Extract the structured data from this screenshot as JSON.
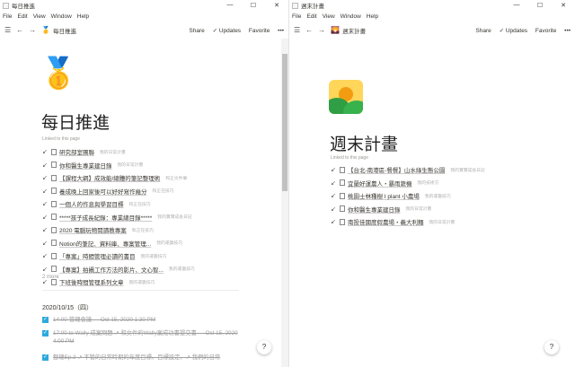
{
  "left": {
    "titlebar": "每日推進",
    "menu": [
      "File",
      "Edit",
      "View",
      "Window",
      "Help"
    ],
    "breadcrumb": "每日推進",
    "toolbar": {
      "share": "Share",
      "updates": "Updates",
      "favorite": "Favorite",
      "more": "•••"
    },
    "page_icon": "🥇",
    "title": "每日推進",
    "linked_label": "Linked to this page",
    "links": [
      {
        "title": "研究部室團聯",
        "sub": "我的日常計畫"
      },
      {
        "title": "你和醫生專業建日錄",
        "sub": "我的日常計畫"
      },
      {
        "title": "【課程大綱】成效能/總體的筆記整理術",
        "sub": "和正文件筆"
      },
      {
        "title": "養成晚上回家後可以好好寫作幾分",
        "sub": "和正在技巧"
      },
      {
        "title": "一個人的作息與學習目標",
        "sub": "和正在技巧"
      },
      {
        "title": "*****孩子成長紀錄：專業總目錄*****",
        "sub": "我的寶寶成長日記"
      },
      {
        "title": "2020 電腦玩物閱讀教專案",
        "sub": "和正在技巧"
      },
      {
        "title": "Notion的筆記、資料庫、專案管理...",
        "sub": "我的運籌技巧"
      },
      {
        "title": "「專案」時間管理必讀的書目",
        "sub": "我的運籌技巧"
      },
      {
        "title": "【專案】拍攝工作方法的影片、文心智...",
        "sub": "我的運籌技巧"
      },
      {
        "title": "下班後時間管理系列文章",
        "sub": "我的運籌技巧"
      }
    ],
    "more": "2 more",
    "date": "2020/10/15（四）",
    "todos": [
      {
        "text": "14:00-管理會議 — Oct 15, 2020 1:30 PM"
      },
      {
        "text": "17:00 to Wally 成案問題 ↗ 和文件的Wally案成功書提交書 — Oct 15, 2020 4:00 PM"
      },
      {
        "text": "整理Ep.3 ↗ 不管的日常時期的年度目標、目標設定、↗ 我們的日常"
      }
    ],
    "help": "?"
  },
  "right": {
    "titlebar": "週末計畫",
    "menu": [
      "File",
      "Edit",
      "View",
      "Window",
      "Help"
    ],
    "breadcrumb": "週末計畫",
    "toolbar": {
      "share": "Share",
      "updates": "Updates",
      "favorite": "Favorite",
      "more": "•••"
    },
    "title": "週末計畫",
    "linked_label": "Linked to this page",
    "links": [
      {
        "title": "【台北-南港區-餐餐】山水綠生態公園",
        "sub": "我的寶寶成長日記"
      },
      {
        "title": "宜蘭好運農人・暴雨蔬機",
        "sub": "我的技術方"
      },
      {
        "title": "桃園士林種樹 I plant 小農場",
        "sub": "我的運籌技巧"
      },
      {
        "title": "你和醫生專業建日錄",
        "sub": "我的日常計畫"
      },
      {
        "title": "南投佳國度假農場・義大利麵",
        "sub": "我的日常計畫"
      }
    ],
    "help": "?"
  },
  "colors": {
    "checkbox": "#2eaadc",
    "text": "#37352f",
    "muted": "#9b9a97"
  }
}
